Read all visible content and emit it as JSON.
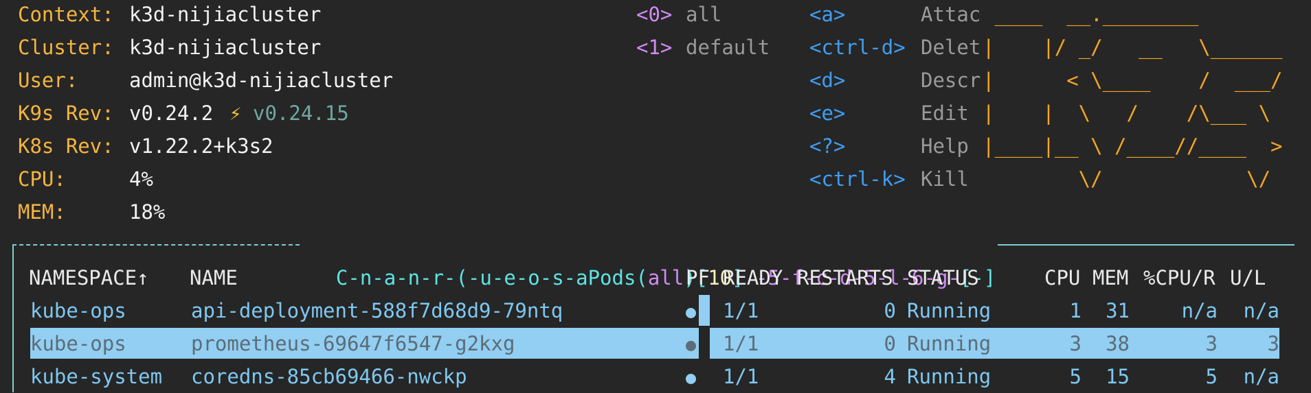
{
  "info": [
    {
      "label": "Context:",
      "value": "k3d-nijiacluster"
    },
    {
      "label": "Cluster:",
      "value": "k3d-nijiacluster"
    },
    {
      "label": "User:",
      "value": "admin@k3d-nijiacluster"
    },
    {
      "label": "K9s Rev:",
      "value": "v0.24.2",
      "extra_icon": "⚡",
      "extra": "v0.24.15"
    },
    {
      "label": "K8s Rev:",
      "value": "v1.22.2+k3s2"
    },
    {
      "label": "CPU:",
      "value": "4%"
    },
    {
      "label": "MEM:",
      "value": "18%"
    }
  ],
  "namespaces": [
    {
      "key": "<0>",
      "name": "all"
    },
    {
      "key": "<1>",
      "name": "default"
    }
  ],
  "hotkeys": [
    {
      "key": "<a>",
      "action": "Attac"
    },
    {
      "key": "<ctrl-d>",
      "action": "Delet"
    },
    {
      "key": "<d>",
      "action": "Descr"
    },
    {
      "key": "<e>",
      "action": "Edit"
    },
    {
      "key": "<?>",
      "action": "Help"
    },
    {
      "key": "<ctrl-k>",
      "action": "Kill"
    }
  ],
  "logo_lines": [
    " ____  __.________",
    "|    |/ _/   __   \\______",
    "|      < \\____    /  ___/",
    "|    |  \\   /    /\\___ \\",
    "|____|__ \\ /____//____  >",
    "        \\/            \\/"
  ],
  "frame_title": {
    "prefix_pink": "",
    "glitch": "C-n-a-n-r-(-u-e-o-s-a",
    "resource": "Pods",
    "scope": "all",
    "count": "10",
    "suffix": "-5-f-c-d-5-l-6-g-",
    "filter": "[-]"
  },
  "table": {
    "headers": {
      "namespace": "NAMESPACE↑",
      "name": "NAME",
      "pf": "PF",
      "ready": "READY",
      "restarts": "RESTARTS",
      "status": "STATUS",
      "cpu": "CPU",
      "mem": "MEM",
      "cpu_r": "%CPU/R",
      "ul": "U/L"
    },
    "rows": [
      {
        "namespace": "kube-ops",
        "name": "api-deployment-588f7d68d9-79ntq",
        "pf": "●",
        "ready": "1/1",
        "restarts": "0",
        "status": "Running",
        "cpu": "1",
        "mem": "31",
        "cpu_r": "n/a",
        "ul": "n/a"
      },
      {
        "namespace": "kube-ops",
        "name": "prometheus-69647f6547-g2kxg",
        "pf": "●",
        "ready": "1/1",
        "restarts": "0",
        "status": "Running",
        "cpu": "3",
        "mem": "38",
        "cpu_r": "3",
        "ul": "3"
      },
      {
        "namespace": "kube-system",
        "name": "coredns-85cb69466-nwckp",
        "pf": "●",
        "ready": "1/1",
        "restarts": "4",
        "status": "Running",
        "cpu": "5",
        "mem": "15",
        "cpu_r": "5",
        "ul": "n/a"
      }
    ]
  }
}
